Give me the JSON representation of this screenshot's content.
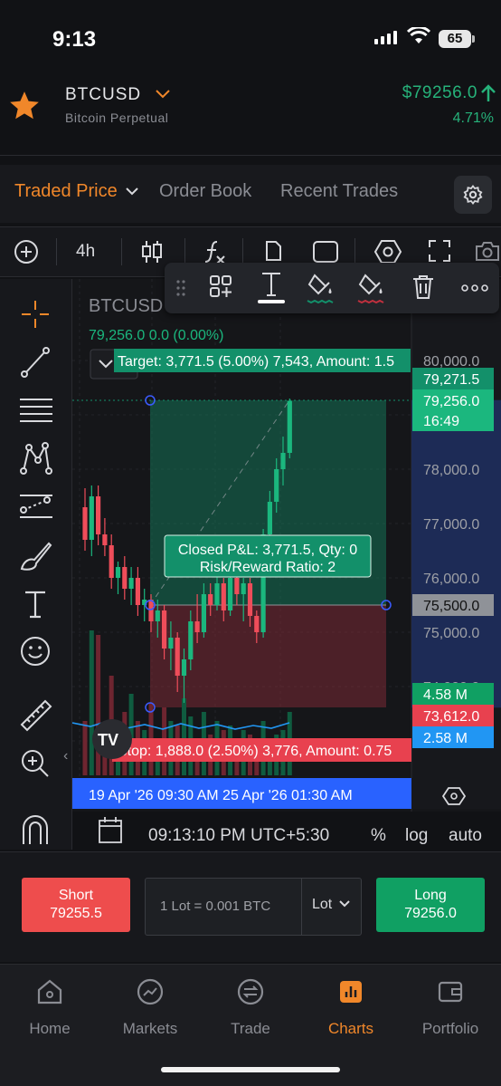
{
  "status": {
    "time": "9:13",
    "battery": "65"
  },
  "symbol": {
    "ticker": "BTCUSD",
    "name": "Bitcoin Perpetual",
    "price": "$79256.0",
    "change_pct": "4.71%"
  },
  "tabs": [
    {
      "label": "Traded Price",
      "active": true
    },
    {
      "label": "Order Book",
      "active": false
    },
    {
      "label": "Recent Trades",
      "active": false
    }
  ],
  "toolbar": {
    "interval": "4h"
  },
  "chart": {
    "legend_symbol": "BTCUSD",
    "legend_values": "79,256.0  0.0 (0.00%)",
    "indicator_count": "4",
    "target_label": "Target: 3,771.5 (5.00%) 7,543, Amount: 1.5",
    "stop_label": "Stop: 1,888.0 (2.50%) 3,776, Amount: 0.75",
    "pnl_line1": "Closed P&L: 3,771.5, Qty: 0",
    "pnl_line2": "Risk/Reward Ratio: 2",
    "price_axis": [
      "80,000.0",
      "78,000.0",
      "77,000.0",
      "76,000.0",
      "75,000.0",
      "74,000.0"
    ],
    "axis_tags": {
      "target": "79,271.5",
      "last": "79,256.0",
      "countdown": "16:49",
      "entry": "75,500.0",
      "vol1": "4.58 M",
      "stop": "73,612.0",
      "vol2": "2.58 M"
    },
    "time_range": "19 Apr '26   09:30 AM   25 Apr '26   01:30 AM",
    "clock": "09:13:10 PM UTC+5:30",
    "pct_label": "%",
    "log_label": "log",
    "auto_label": "auto",
    "colors": {
      "up": "#1bb77e",
      "down": "#ef4d5a",
      "target": "#13906a",
      "stop": "#e8414f",
      "blue": "#2962ff"
    }
  },
  "chart_data": {
    "type": "candlestick",
    "ylim": [
      73200,
      80400
    ],
    "candles": [
      [
        0,
        77300,
        77650,
        76500,
        76700
      ],
      [
        1,
        76700,
        77700,
        76400,
        77500
      ],
      [
        2,
        77500,
        77700,
        76600,
        76800
      ],
      [
        3,
        76800,
        77100,
        76400,
        76600
      ],
      [
        4,
        76600,
        76800,
        75800,
        76000
      ],
      [
        5,
        76000,
        76300,
        75700,
        76200
      ],
      [
        6,
        76200,
        76400,
        75600,
        75800
      ],
      [
        7,
        75800,
        76200,
        75500,
        76000
      ],
      [
        8,
        76000,
        76200,
        75300,
        75500
      ],
      [
        9,
        75500,
        75800,
        75200,
        75600
      ],
      [
        10,
        75600,
        75700,
        75000,
        75200
      ],
      [
        11,
        75200,
        75600,
        74900,
        75400
      ],
      [
        12,
        75400,
        75500,
        74500,
        74700
      ],
      [
        13,
        74700,
        75200,
        74300,
        74900
      ],
      [
        14,
        74900,
        75000,
        73900,
        74200
      ],
      [
        15,
        74200,
        74700,
        73700,
        74500
      ],
      [
        16,
        74500,
        75400,
        74300,
        75200
      ],
      [
        17,
        75200,
        75700,
        74800,
        75000
      ],
      [
        18,
        75000,
        75900,
        74900,
        75700
      ],
      [
        19,
        75700,
        75900,
        75300,
        75500
      ],
      [
        20,
        75500,
        76100,
        75400,
        75900
      ],
      [
        21,
        75900,
        76000,
        75200,
        75400
      ],
      [
        22,
        75400,
        76200,
        75300,
        76000
      ],
      [
        23,
        76000,
        76100,
        75500,
        75700
      ],
      [
        24,
        75700,
        76000,
        75200,
        75900
      ],
      [
        25,
        75900,
        76000,
        75100,
        75300
      ],
      [
        26,
        75300,
        75400,
        74800,
        75000
      ],
      [
        27,
        75000,
        76900,
        74900,
        76800
      ],
      [
        28,
        76800,
        77600,
        76600,
        77400
      ],
      [
        29,
        77400,
        78200,
        77200,
        78000
      ],
      [
        30,
        78000,
        78600,
        77700,
        78300
      ],
      [
        31,
        78300,
        79300,
        78200,
        79256
      ]
    ]
  },
  "actions": {
    "short_label": "Short",
    "short_price": "79255.5",
    "lot_text": "1 Lot = 0.001 BTC",
    "lot_unit": "Lot",
    "long_label": "Long",
    "long_price": "79256.0"
  },
  "nav": [
    {
      "label": "Home",
      "icon": "home-icon",
      "active": false
    },
    {
      "label": "Markets",
      "icon": "markets-icon",
      "active": false
    },
    {
      "label": "Trade",
      "icon": "trade-icon",
      "active": false
    },
    {
      "label": "Charts",
      "icon": "charts-icon",
      "active": true
    },
    {
      "label": "Portfolio",
      "icon": "portfolio-icon",
      "active": false
    }
  ]
}
